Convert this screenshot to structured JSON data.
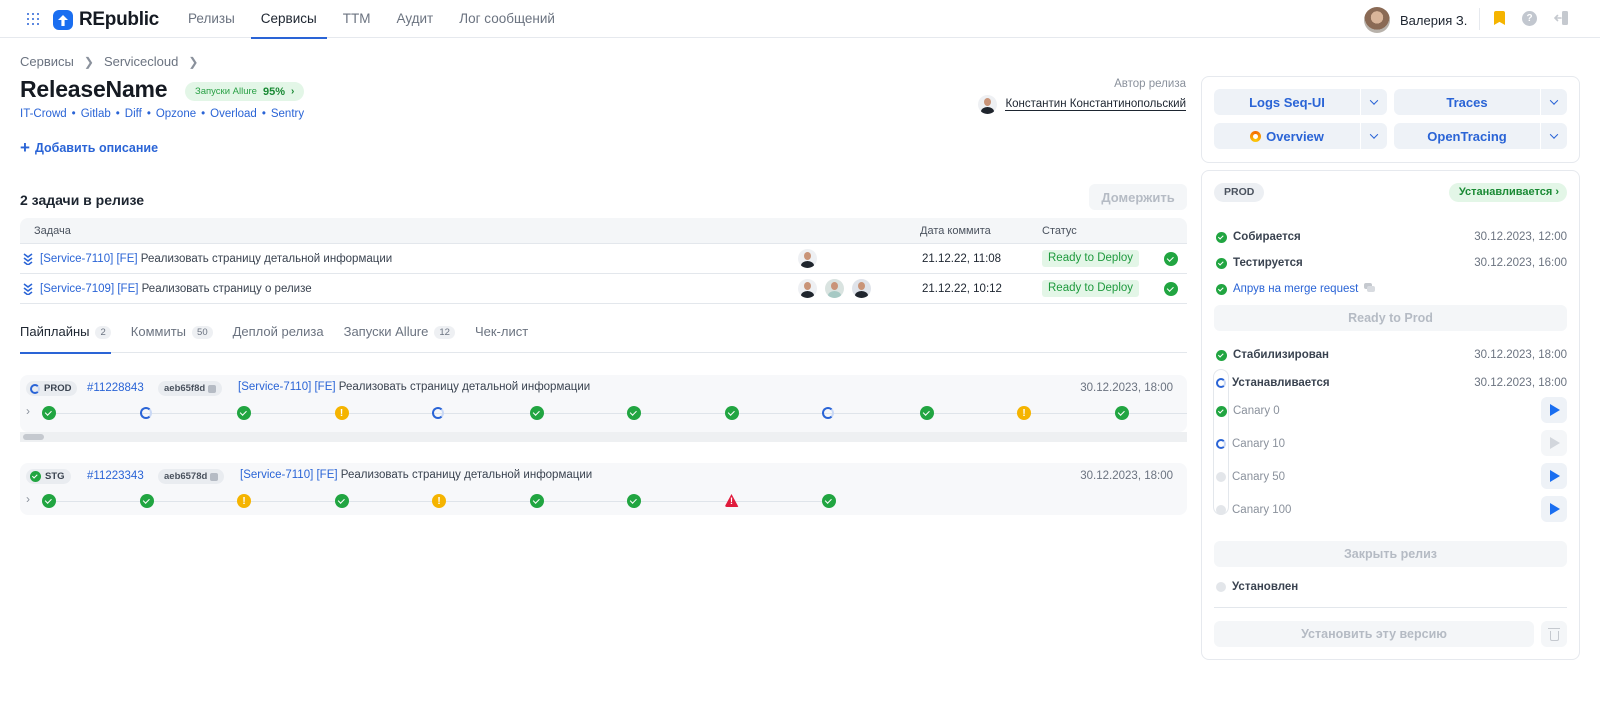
{
  "app": {
    "name": "REpublic",
    "nav": [
      {
        "label": "Релизы",
        "active": false
      },
      {
        "label": "Сервисы",
        "active": true
      },
      {
        "label": "TTM",
        "active": false
      },
      {
        "label": "Аудит",
        "active": false
      },
      {
        "label": "Лог сообщений",
        "active": false
      }
    ],
    "user": {
      "name": "Валерия З."
    },
    "icons": [
      "apps-grid-icon",
      "bookmark-icon",
      "help-icon",
      "logout-icon"
    ]
  },
  "breadcrumb": [
    "Сервисы",
    "Servicecloud"
  ],
  "release": {
    "title": "ReleaseName",
    "allure_badge": {
      "label": "Запуски Allure",
      "value": "95%"
    },
    "links": [
      "IT-Crowd",
      "Gitlab",
      "Diff",
      "Opzone",
      "Overload",
      "Sentry"
    ],
    "add_description": "Добавить описание",
    "author_label": "Автор релиза",
    "author_name": "Константин Константинопольский"
  },
  "tasks": {
    "title": "2 задачи в релизе",
    "merge_button": "Домержить",
    "columns": {
      "task": "Задача",
      "commit_date": "Дата коммита",
      "status": "Статус"
    },
    "rows": [
      {
        "key": "[Service-7110] [FE]",
        "title": "Реализовать страницу детальной информации",
        "avatars": 1,
        "date": "21.12.22, 11:08",
        "status": "Ready to Deploy"
      },
      {
        "key": "[Service-7109] [FE]",
        "title": "Реализовать страницу о релизе",
        "avatars": 3,
        "date": "21.12.22, 10:12",
        "status": "Ready to Deploy"
      }
    ]
  },
  "tabs": [
    {
      "label": "Пайплайны",
      "count": "2",
      "active": true
    },
    {
      "label": "Коммиты",
      "count": "50",
      "active": false
    },
    {
      "label": "Деплой релиза",
      "count": null,
      "active": false
    },
    {
      "label": "Запуски Allure",
      "count": "12",
      "active": false
    },
    {
      "label": "Чек-лист",
      "count": null,
      "active": false
    }
  ],
  "pipelines": [
    {
      "env": "PROD",
      "env_status": "running",
      "id": "#11228843",
      "sha": "aeb65f8d",
      "key": "[Service-7110] [FE]",
      "title": "Реализовать страницу детальной информации",
      "date": "30.12.2023, 18:00",
      "stages": [
        "success",
        "running",
        "success",
        "warning",
        "running",
        "success",
        "success",
        "success",
        "running",
        "success",
        "warning",
        "success"
      ]
    },
    {
      "env": "STG",
      "env_status": "success",
      "id": "#11223343",
      "sha": "aeb6578d",
      "key": "[Service-7110] [FE]",
      "title": "Реализовать страницу детальной информации",
      "date": "30.12.2023, 18:00",
      "stages": [
        "success",
        "success",
        "warning",
        "success",
        "warning",
        "success",
        "success",
        "error",
        "success"
      ]
    }
  ],
  "quick_links": [
    {
      "label": "Logs Seq-UI",
      "icon": null
    },
    {
      "label": "Traces",
      "icon": null
    },
    {
      "label": "Overview",
      "icon": "grafana-icon"
    },
    {
      "label": "OpenTracing",
      "icon": null
    }
  ],
  "deploy": {
    "env": "PROD",
    "status": "Устанавливается",
    "steps": [
      {
        "name": "Собирается",
        "time": "30.12.2023, 12:00",
        "state": "success"
      },
      {
        "name": "Тестируется",
        "time": "30.12.2023, 16:00",
        "state": "success"
      },
      {
        "name": "Апрув на merge request",
        "time": "",
        "state": "success",
        "link": true
      }
    ],
    "ready_button": "Ready to Prod",
    "steps2": [
      {
        "name": "Стабилизирован",
        "time": "30.12.2023, 18:00",
        "state": "success"
      },
      {
        "name": "Устанавливается",
        "time": "30.12.2023, 18:00",
        "state": "running"
      }
    ],
    "canaries": [
      {
        "name": "Canary 0",
        "state": "success",
        "play_enabled": true
      },
      {
        "name": "Canary 10",
        "state": "running",
        "play_enabled": false
      },
      {
        "name": "Canary 50",
        "state": "pending",
        "play_enabled": true
      },
      {
        "name": "Canary 100",
        "state": "pending",
        "play_enabled": true
      }
    ],
    "close_button": "Закрыть релиз",
    "installed": {
      "name": "Установлен",
      "state": "pending"
    },
    "install_button": "Установить эту версию"
  }
}
